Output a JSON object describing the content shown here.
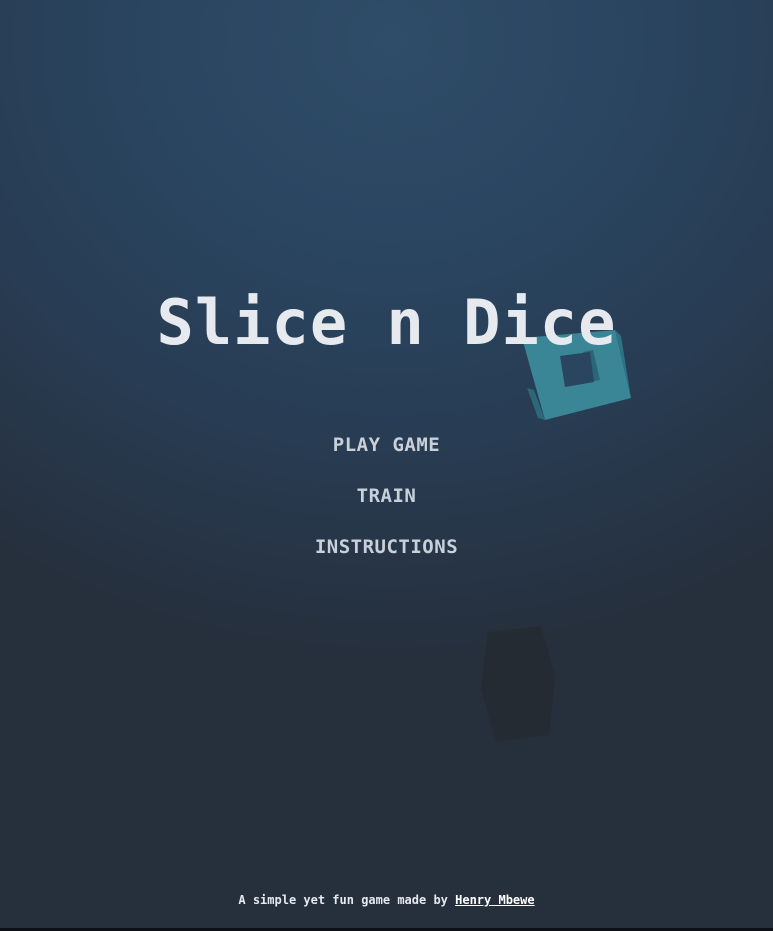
{
  "title": "Slice n Dice",
  "menu": {
    "items": [
      {
        "label": "PLAY GAME"
      },
      {
        "label": "TRAIN"
      },
      {
        "label": "INSTRUCTIONS"
      }
    ]
  },
  "footer": {
    "text": "A simple yet fun game made by ",
    "author": "Henry Mbewe"
  },
  "colors": {
    "background_top": "#2f4c68",
    "background_bottom": "#262f3c",
    "title": "#e6e9ee",
    "menu_text": "#c9d0da",
    "teal_cube": "#3a8596",
    "dark_cube": "#252b33"
  }
}
